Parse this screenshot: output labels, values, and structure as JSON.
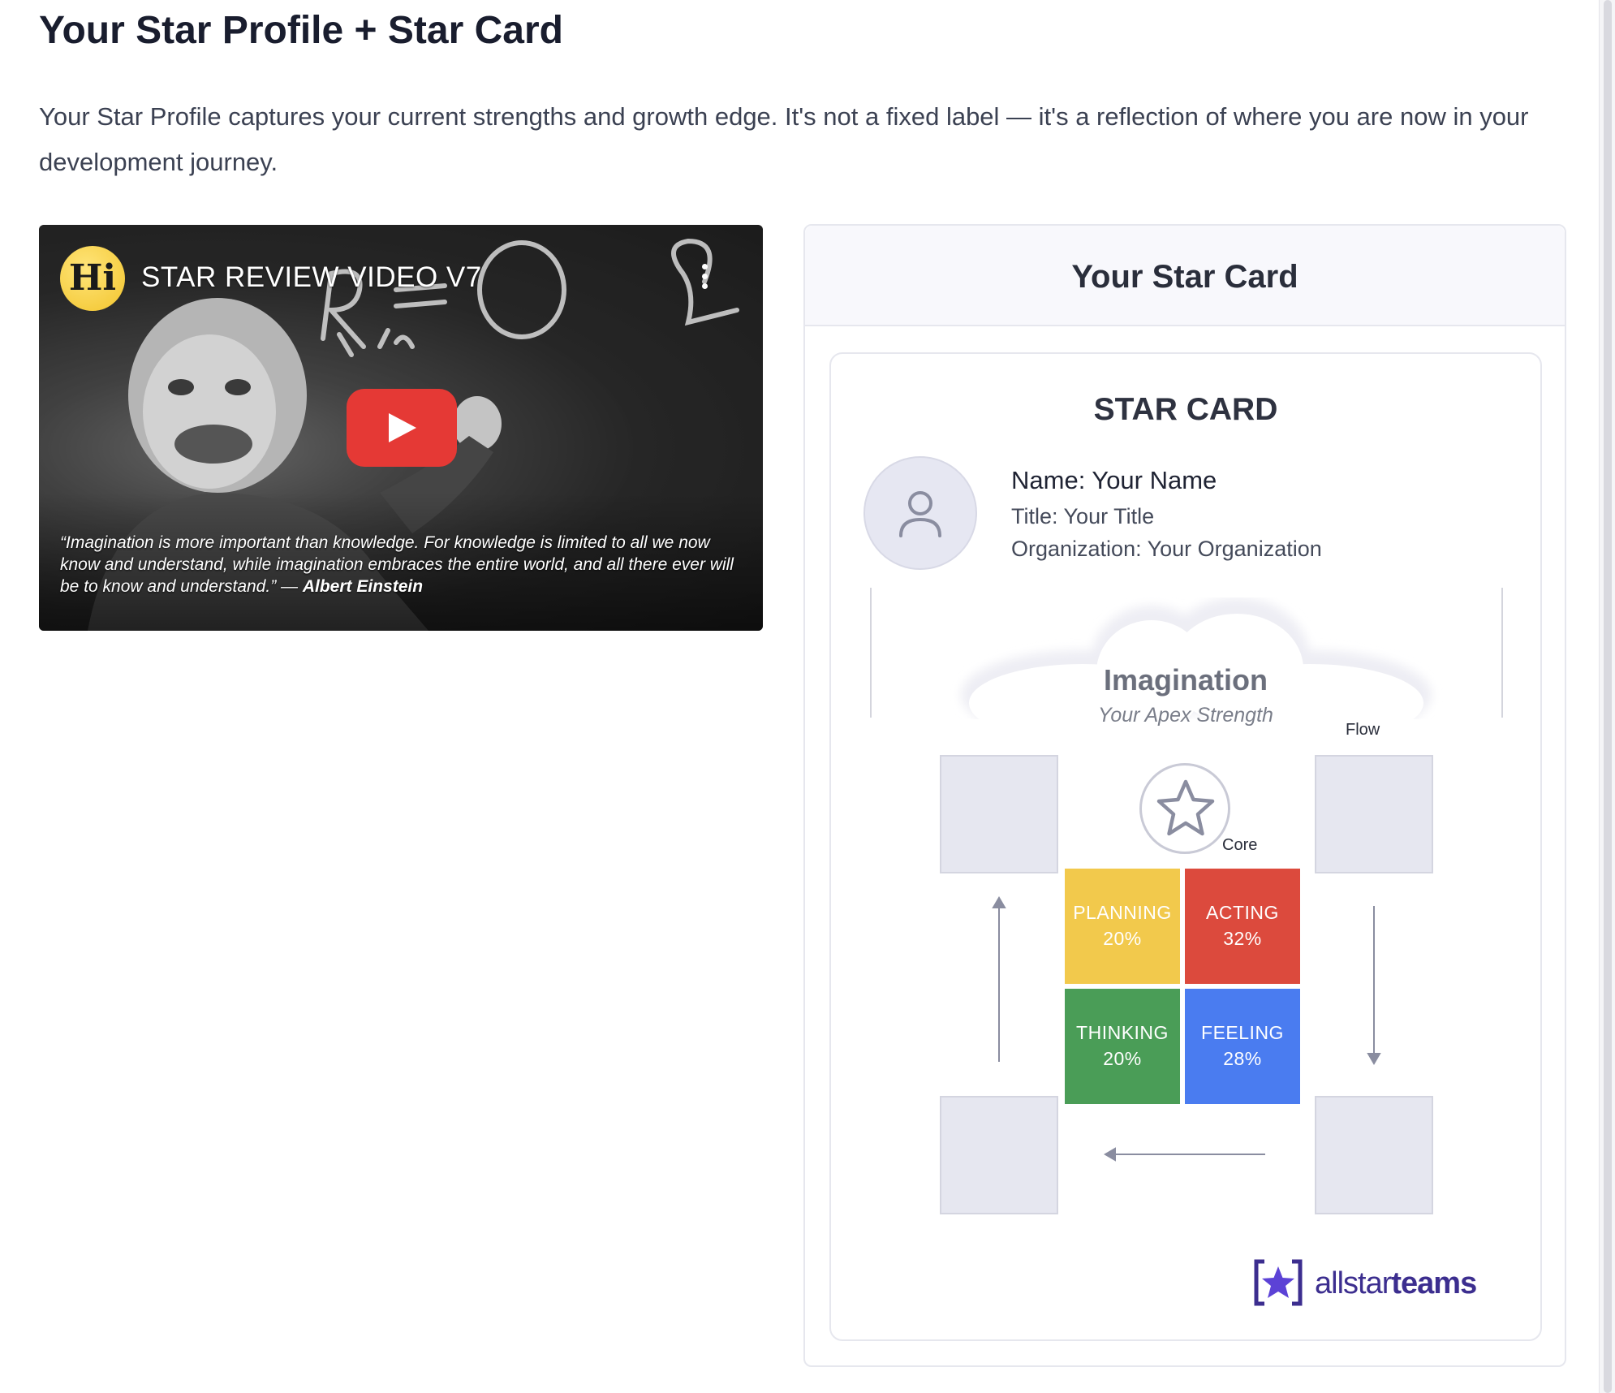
{
  "page": {
    "title": "Your Star Profile + Star Card",
    "intro": "Your Star Profile captures your current strengths and growth edge. It's not a fixed label — it's a reflection of where you are now in your development journey."
  },
  "video": {
    "channel_logo": "Hi",
    "title": "STAR REVIEW VIDEO V7",
    "menu_icon": "more-vertical-icon",
    "play_icon": "youtube-play-icon",
    "quote": "“Imagination is more important than knowledge. For knowledge is limited to all we now know and understand, while imagination embraces the entire world, and all there ever will be to know and understand.” —",
    "quote_author": "Albert Einstein",
    "chalk_text": "R ik = 0 2"
  },
  "star_card_panel": {
    "header": "Your Star Card",
    "card": {
      "heading": "STAR CARD",
      "avatar_icon": "user-icon",
      "name": "Name: Your Name",
      "title": "Title: Your Title",
      "organization": "Organization: Your Organization",
      "apex": {
        "name": "Imagination",
        "subtitle": "Your Apex Strength"
      },
      "flow_label": "Flow",
      "core_label": "Core",
      "core_icon": "star-outline-icon",
      "quadrants": [
        {
          "label": "PLANNING",
          "percent": "20%",
          "value": 20,
          "color": "#f2c94c"
        },
        {
          "label": "ACTING",
          "percent": "32%",
          "value": 32,
          "color": "#dc4a3d"
        },
        {
          "label": "THINKING",
          "percent": "20%",
          "value": 20,
          "color": "#4a9d57"
        },
        {
          "label": "FEELING",
          "percent": "28%",
          "value": 28,
          "color": "#4a7cf0"
        }
      ],
      "brand": {
        "logo_icon": "allstarteams-star-logo-icon",
        "name_light": "allstar",
        "name_bold": "teams",
        "color": "#3c2e8f"
      }
    }
  },
  "colors": {
    "flow_box": "#e6e7f0",
    "youtube_red": "#e53935",
    "hi_yellow": "#f2c42c"
  }
}
